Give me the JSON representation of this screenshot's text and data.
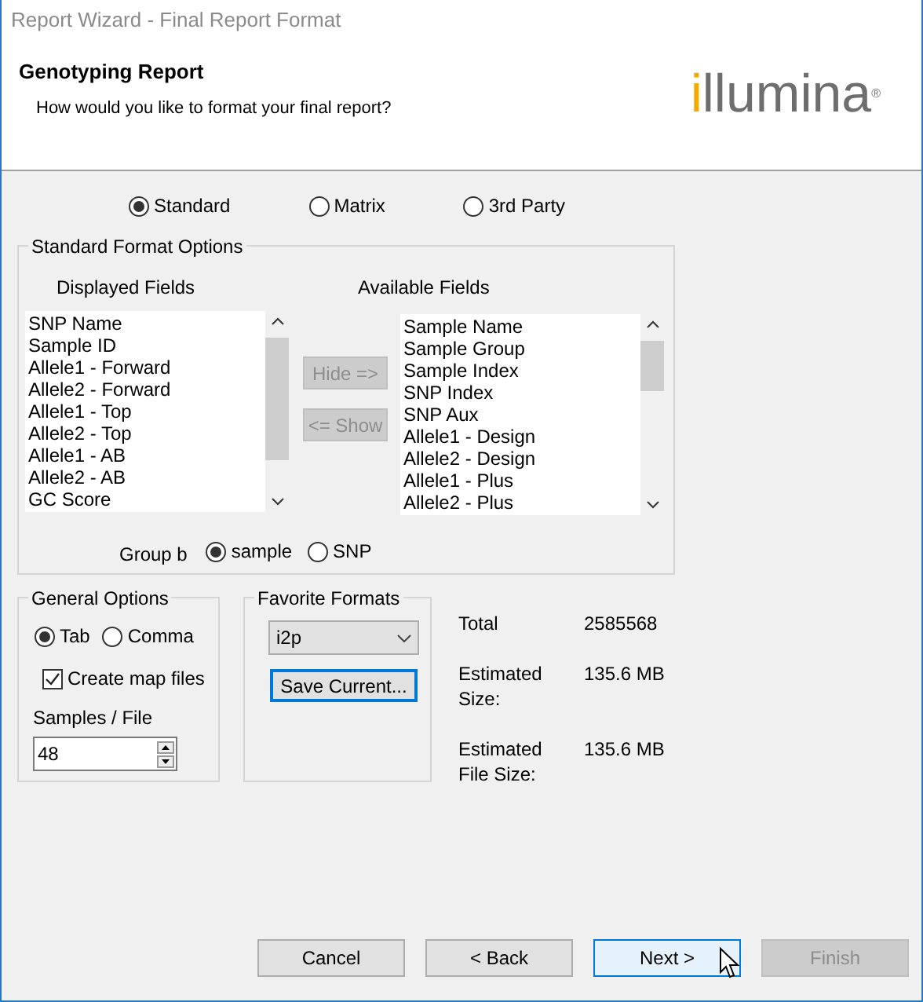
{
  "window": {
    "title": "Report Wizard - Final Report Format"
  },
  "header": {
    "title": "Genotyping Report",
    "subtitle": "How would you like to format your final report?",
    "logo": {
      "dot_part": "i",
      "rest": "llumina",
      "mark": "®"
    }
  },
  "format_options": [
    {
      "label": "Standard",
      "selected": true
    },
    {
      "label": "Matrix",
      "selected": false
    },
    {
      "label": "3rd Party",
      "selected": false
    }
  ],
  "standard_format_options": {
    "title": "Standard Format Options",
    "displayed_fields": {
      "label": "Displayed Fields",
      "items": [
        "SNP Name",
        "Sample ID",
        "Allele1 - Forward",
        "Allele2 - Forward",
        "Allele1 - Top",
        "Allele2 - Top",
        "Allele1 - AB",
        "Allele2 - AB",
        "GC Score"
      ]
    },
    "move_buttons": [
      {
        "label": "Hide =>",
        "disabled": true
      },
      {
        "label": "<= Show",
        "disabled": true
      }
    ],
    "available_fields": {
      "label": "Available Fields",
      "items": [
        "Sample Name",
        "Sample Group",
        "Sample Index",
        "SNP Index",
        "SNP Aux",
        "Allele1 - Design",
        "Allele2 - Design",
        "Allele1 - Plus",
        "Allele2 - Plus"
      ]
    },
    "group_by": {
      "label": "Group b",
      "options": [
        {
          "label": "sample",
          "selected": true
        },
        {
          "label": "SNP",
          "selected": false
        }
      ]
    }
  },
  "general_options": {
    "title": "General Options",
    "separators": [
      {
        "label": "Tab",
        "selected": true
      },
      {
        "label": "Comma",
        "selected": false
      }
    ],
    "create_map_files": {
      "label": "Create map files",
      "checked": true
    },
    "samples_per_file": {
      "label": "Samples / File",
      "value": "48"
    }
  },
  "favorite_formats": {
    "title": "Favorite Formats",
    "value": "i2p",
    "save_button": {
      "label": "Save Current...",
      "focused": true
    }
  },
  "summary": [
    {
      "label": "Total",
      "value": "2585568"
    },
    {
      "label": "Estimated Size:",
      "value": "135.6 MB"
    },
    {
      "label": "Estimated File Size:",
      "value": "135.6 MB"
    }
  ],
  "buttons": [
    {
      "label": "Cancel",
      "disabled": false,
      "focused": false
    },
    {
      "label": "< Back",
      "disabled": false,
      "focused": false
    },
    {
      "label": "Next >",
      "disabled": false,
      "focused": true
    },
    {
      "label": "Finish",
      "disabled": true,
      "focused": false
    }
  ]
}
